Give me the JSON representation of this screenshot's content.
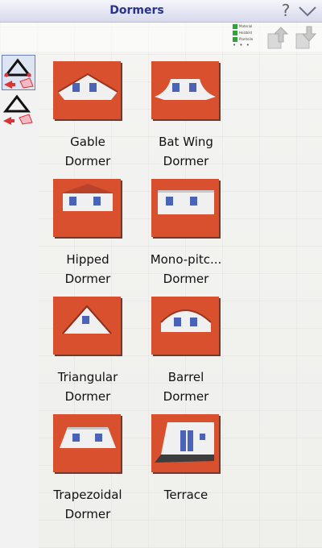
{
  "window": {
    "title": "Dormers",
    "help_glyph": "?",
    "collapse_icon": "chevron-down-icon"
  },
  "toolbar": {
    "legend": [
      {
        "label": "Material",
        "color": "#2fa33a"
      },
      {
        "label": "Holzbild",
        "color": "#2fa33a"
      },
      {
        "label": "Planteile",
        "color": "#2fa33a"
      }
    ],
    "legend_more": "• • •",
    "buttons": [
      {
        "icon": "export-up-icon"
      },
      {
        "icon": "import-down-icon"
      }
    ]
  },
  "sidebar": {
    "tools": [
      {
        "icon": "dormer-on-roof-tool-icon",
        "selected": true
      },
      {
        "icon": "dormer-on-roof-tool-alt-icon",
        "selected": false
      }
    ]
  },
  "items": [
    {
      "name": "gable-dormer",
      "label": "Gable\nDormer",
      "icon": "gable-dormer-icon"
    },
    {
      "name": "bat-wing-dormer",
      "label": "Bat Wing\nDormer",
      "icon": "bat-wing-dormer-icon"
    },
    {
      "name": "hipped-dormer",
      "label": "Hipped\nDormer",
      "icon": "hipped-dormer-icon"
    },
    {
      "name": "mono-pitch-dormer",
      "label": "Mono-pitc...\nDormer",
      "icon": "mono-pitch-dormer-icon"
    },
    {
      "name": "triangular-dormer",
      "label": "Triangular\nDormer",
      "icon": "triangular-dormer-icon"
    },
    {
      "name": "barrel-dormer",
      "label": "Barrel\nDormer",
      "icon": "barrel-dormer-icon"
    },
    {
      "name": "trapezoidal-dormer",
      "label": "Trapezoidal\nDormer",
      "icon": "trapezoidal-dormer-icon"
    },
    {
      "name": "terrace",
      "label": "Terrace",
      "icon": "terrace-icon"
    }
  ],
  "colors": {
    "title": "#27338f",
    "roof": "#d9502e",
    "selection": "#6a7ec1"
  }
}
